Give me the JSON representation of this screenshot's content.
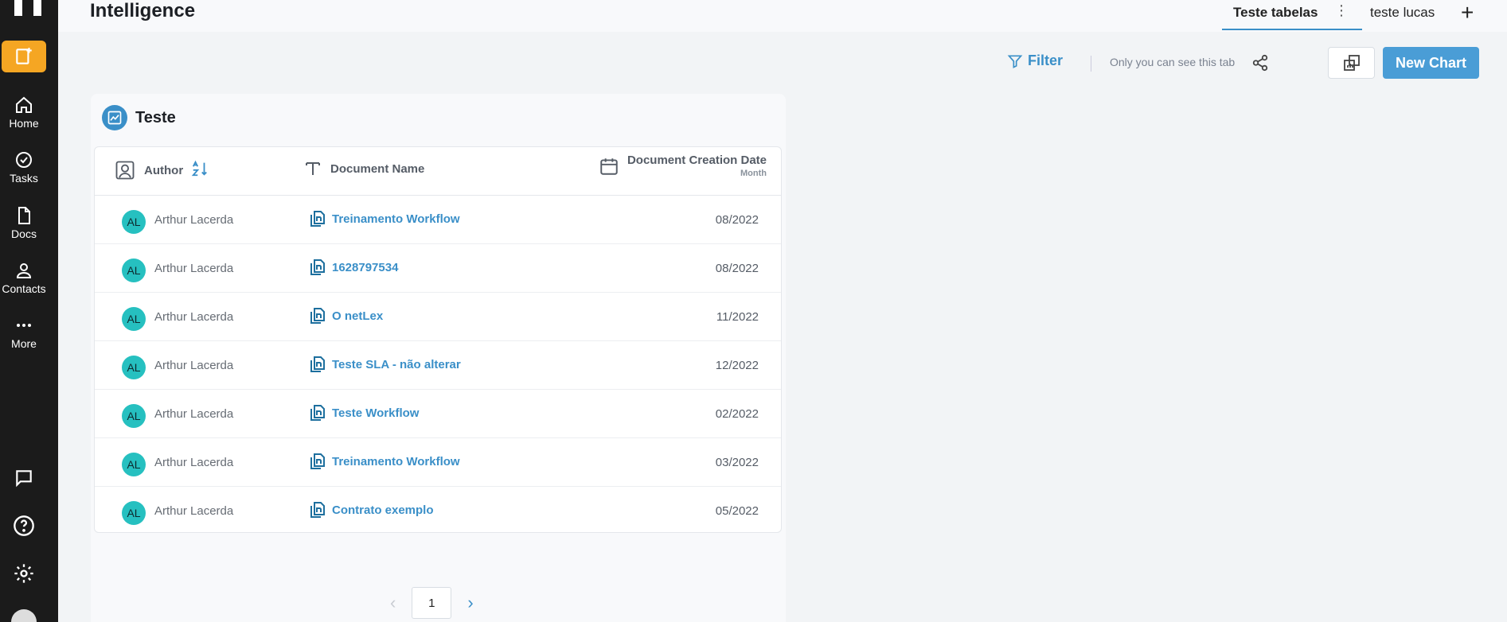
{
  "header": {
    "title": "Intelligence",
    "tabs": [
      {
        "label": "Teste tabelas",
        "active": true
      },
      {
        "label": "teste lucas",
        "active": false
      }
    ],
    "add_tab": "+",
    "tab_menu": "⋮"
  },
  "sidebar": {
    "items": [
      {
        "label": "Home",
        "icon": "home-icon"
      },
      {
        "label": "Tasks",
        "icon": "check-circle-icon"
      },
      {
        "label": "Docs",
        "icon": "document-icon"
      },
      {
        "label": "Contacts",
        "icon": "person-icon"
      },
      {
        "label": "More",
        "icon": "more-dots-icon"
      }
    ],
    "bottom_icons": [
      "chat-icon",
      "help-icon",
      "settings-icon"
    ],
    "accent": "#f5a623"
  },
  "toolbar": {
    "filter_label": "Filter",
    "private_note": "Only you can see this tab",
    "new_chart_label": "New Chart"
  },
  "card": {
    "title": "Teste",
    "columns": {
      "author": "Author",
      "document_name": "Document Name",
      "creation_date": "Document Creation Date",
      "creation_date_sub": "Month"
    },
    "rows": [
      {
        "initials": "AL",
        "author": "Arthur Lacerda",
        "document": "Treinamento Workflow",
        "date": "08/2022"
      },
      {
        "initials": "AL",
        "author": "Arthur Lacerda",
        "document": "1628797534",
        "date": "08/2022"
      },
      {
        "initials": "AL",
        "author": "Arthur Lacerda",
        "document": "O netLex",
        "date": "11/2022"
      },
      {
        "initials": "AL",
        "author": "Arthur Lacerda",
        "document": "Teste SLA - não alterar",
        "date": "12/2022"
      },
      {
        "initials": "AL",
        "author": "Arthur Lacerda",
        "document": "Teste Workflow",
        "date": "02/2022"
      },
      {
        "initials": "AL",
        "author": "Arthur Lacerda",
        "document": "Treinamento Workflow",
        "date": "03/2022"
      },
      {
        "initials": "AL",
        "author": "Arthur Lacerda",
        "document": "Contrato exemplo",
        "date": "05/2022"
      }
    ]
  },
  "pagination": {
    "current": "1"
  },
  "colors": {
    "link": "#3a8fc8",
    "avatar": "#26c0c0",
    "primary_button": "#4a9dd6"
  }
}
